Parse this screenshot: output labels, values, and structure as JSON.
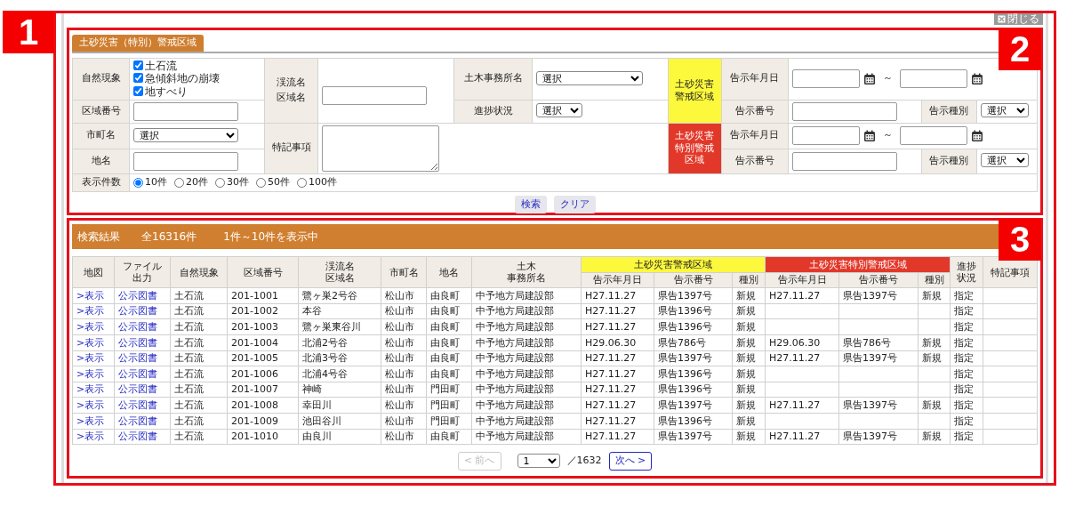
{
  "close_button": {
    "label": "閉じる"
  },
  "callouts": [
    "1",
    "2",
    "3"
  ],
  "search": {
    "tab": "土砂災害（特別）警戒区域",
    "phenomenon": {
      "label": "自然現象",
      "options": [
        {
          "label": "土石流",
          "checked": true
        },
        {
          "label": "急傾斜地の崩壊",
          "checked": true
        },
        {
          "label": "地すべり",
          "checked": true
        }
      ]
    },
    "area_number": {
      "label": "区域番号"
    },
    "city": {
      "label": "市町名",
      "value": "選択"
    },
    "place": {
      "label": "地名"
    },
    "stream": {
      "lines": [
        "渓流名",
        "区域名"
      ]
    },
    "notes": {
      "label": "特記事項"
    },
    "office": {
      "label": "土木事務所名",
      "value": "選択"
    },
    "progress": {
      "label": "進捗状況",
      "value": "選択"
    },
    "zones": [
      {
        "kind": "warning",
        "lines": [
          "土砂災害",
          "警戒区域"
        ],
        "date_label": "告示年月日",
        "separator": "～",
        "number_label": "告示番号",
        "type_label": "告示種別",
        "type_value": "選択"
      },
      {
        "kind": "special",
        "lines": [
          "土砂災害",
          "特別警戒",
          "区域"
        ],
        "date_label": "告示年月日",
        "separator": "～",
        "number_label": "告示番号",
        "type_label": "告示種別",
        "type_value": "選択"
      }
    ],
    "count": {
      "label": "表示件数",
      "options": [
        {
          "label": "10件",
          "selected": true
        },
        {
          "label": "20件",
          "selected": false
        },
        {
          "label": "30件",
          "selected": false
        },
        {
          "label": "50件",
          "selected": false
        },
        {
          "label": "100件",
          "selected": false
        }
      ]
    },
    "buttons": [
      "検索",
      "クリア"
    ]
  },
  "results": {
    "summary": [
      "検索結果",
      "全16316件",
      "1件～10件を表示中"
    ],
    "columns": [
      {
        "label": "地図",
        "kind": "link"
      },
      {
        "label": "ファイル出力",
        "kind": "link"
      },
      {
        "label": "自然現象",
        "kind": "text"
      },
      {
        "label": "区域番号",
        "kind": "text"
      },
      {
        "label": "渓流名区域名",
        "kind": "text"
      },
      {
        "label": "市町名",
        "kind": "text"
      },
      {
        "label": "地名",
        "kind": "text"
      },
      {
        "label": "土木事務所名",
        "kind": "text"
      }
    ],
    "groups": [
      {
        "kind": "warning",
        "label": "土砂災害警戒区域",
        "columns": [
          "告示年月日",
          "告示番号",
          "種別"
        ]
      },
      {
        "kind": "special",
        "label": "土砂災害特別警戒区域",
        "columns": [
          "告示年月日",
          "告示番号",
          "種別"
        ]
      }
    ],
    "trailing_columns": [
      {
        "label": "進捗状況"
      },
      {
        "label": "特記事項"
      }
    ],
    "rows": [
      {
        "cells": [
          ">表示",
          "公示図書",
          "土石流",
          "201-1001",
          "鷺ヶ巣2号谷",
          "松山市",
          "由良町",
          "中予地方局建設部",
          "H27.11.27",
          "県告1397号",
          "新規",
          "H27.11.27",
          "県告1397号",
          "新規",
          "指定",
          ""
        ]
      },
      {
        "cells": [
          ">表示",
          "公示図書",
          "土石流",
          "201-1002",
          "本谷",
          "松山市",
          "由良町",
          "中予地方局建設部",
          "H27.11.27",
          "県告1396号",
          "新規",
          "",
          "",
          "",
          "指定",
          ""
        ]
      },
      {
        "cells": [
          ">表示",
          "公示図書",
          "土石流",
          "201-1003",
          "鷺ヶ巣東谷川",
          "松山市",
          "由良町",
          "中予地方局建設部",
          "H27.11.27",
          "県告1396号",
          "新規",
          "",
          "",
          "",
          "指定",
          ""
        ]
      },
      {
        "cells": [
          ">表示",
          "公示図書",
          "土石流",
          "201-1004",
          "北浦2号谷",
          "松山市",
          "由良町",
          "中予地方局建設部",
          "H29.06.30",
          "県告786号",
          "新規",
          "H29.06.30",
          "県告786号",
          "新規",
          "指定",
          ""
        ]
      },
      {
        "cells": [
          ">表示",
          "公示図書",
          "土石流",
          "201-1005",
          "北浦3号谷",
          "松山市",
          "由良町",
          "中予地方局建設部",
          "H27.11.27",
          "県告1397号",
          "新規",
          "H27.11.27",
          "県告1397号",
          "新規",
          "指定",
          ""
        ]
      },
      {
        "cells": [
          ">表示",
          "公示図書",
          "土石流",
          "201-1006",
          "北浦4号谷",
          "松山市",
          "由良町",
          "中予地方局建設部",
          "H27.11.27",
          "県告1396号",
          "新規",
          "",
          "",
          "",
          "指定",
          ""
        ]
      },
      {
        "cells": [
          ">表示",
          "公示図書",
          "土石流",
          "201-1007",
          "神崎",
          "松山市",
          "門田町",
          "中予地方局建設部",
          "H27.11.27",
          "県告1396号",
          "新規",
          "",
          "",
          "",
          "指定",
          ""
        ]
      },
      {
        "cells": [
          ">表示",
          "公示図書",
          "土石流",
          "201-1008",
          "幸田川",
          "松山市",
          "門田町",
          "中予地方局建設部",
          "H27.11.27",
          "県告1397号",
          "新規",
          "H27.11.27",
          "県告1397号",
          "新規",
          "指定",
          ""
        ]
      },
      {
        "cells": [
          ">表示",
          "公示図書",
          "土石流",
          "201-1009",
          "池田谷川",
          "松山市",
          "門田町",
          "中予地方局建設部",
          "H27.11.27",
          "県告1396号",
          "新規",
          "",
          "",
          "",
          "指定",
          ""
        ]
      },
      {
        "cells": [
          ">表示",
          "公示図書",
          "土石流",
          "201-1010",
          "由良川",
          "松山市",
          "由良町",
          "中予地方局建設部",
          "H27.11.27",
          "県告1397号",
          "新規",
          "H27.11.27",
          "県告1397号",
          "新規",
          "指定",
          ""
        ]
      }
    ],
    "pagination": {
      "prev": {
        "label": "< 前へ",
        "disabled": true
      },
      "page": "1",
      "total": "／1632",
      "next": {
        "label": "次へ >",
        "disabled": false
      }
    }
  }
}
